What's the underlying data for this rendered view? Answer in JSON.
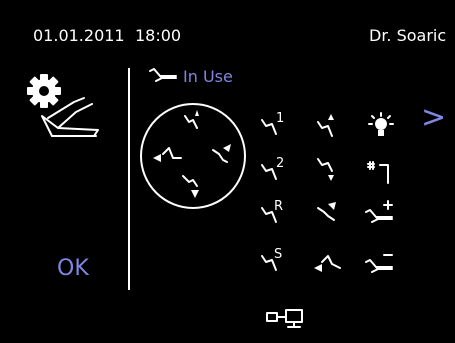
{
  "header": {
    "date": "01.01.2011",
    "time": "18:00",
    "user": "Dr. Soaric"
  },
  "status": {
    "label": "In Use"
  },
  "buttons": {
    "ok": "OK",
    "next": ">"
  },
  "grid_labels": {
    "pos1": "1",
    "pos2": "2",
    "posR": "R",
    "posS": "S"
  },
  "icons": {
    "settings": "gear-icon",
    "foot_pedal": "foot-control-icon",
    "chair": "chair-icon",
    "light": "operating-light-icon",
    "cup_filler": "cup-filler-icon",
    "monitor": "monitor-icon"
  },
  "colors": {
    "background": "#000000",
    "foreground": "#ffffff",
    "accent": "#7f86e0"
  }
}
